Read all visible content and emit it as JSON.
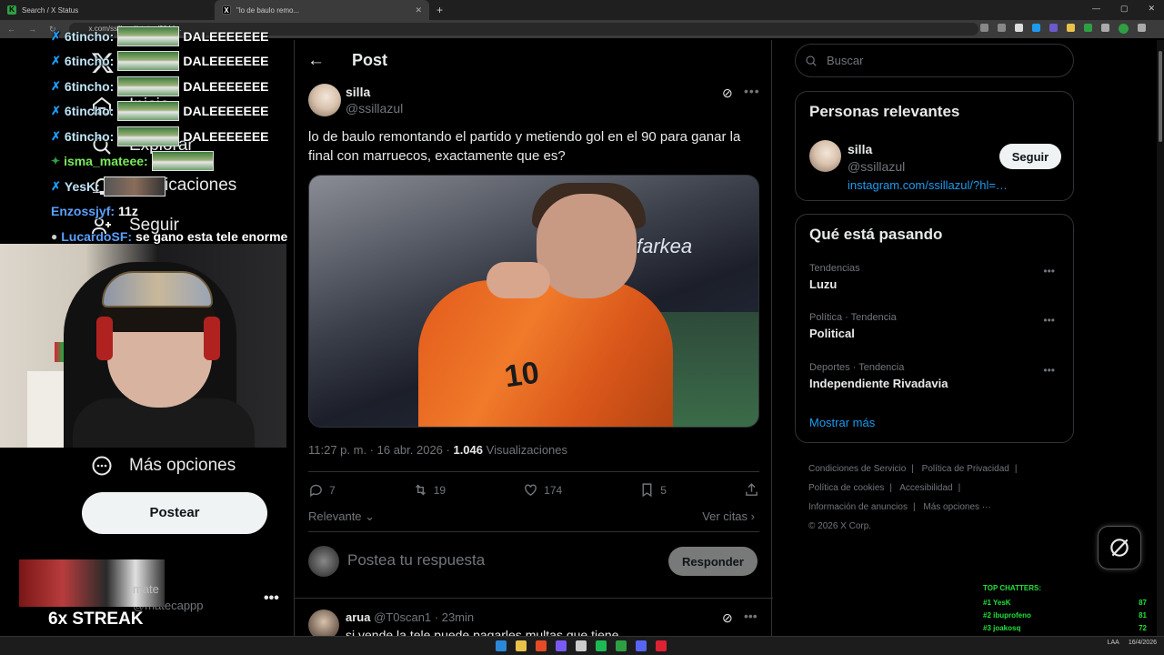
{
  "browser": {
    "tabs": [
      {
        "title": "Search / X Status"
      },
      {
        "title": "\"lo de baulo remo..."
      }
    ],
    "new_tab": "+",
    "url": "x.com/ssillazul/status/2044..."
  },
  "chat_overlay": {
    "lines": [
      {
        "user": "6tincho:",
        "msg": "DALEEEEEEE"
      },
      {
        "user": "6tincho:",
        "msg": "DALEEEEEEE"
      },
      {
        "user": "6tincho:",
        "msg": "DALEEEEEEE"
      },
      {
        "user": "6tincho:",
        "msg": "DALEEEEEEE"
      },
      {
        "user": "6tincho:",
        "msg": "DALEEEEEEE"
      },
      {
        "user": "isma_mateee:",
        "msg": ""
      },
      {
        "user": "YesK:",
        "msg": ""
      },
      {
        "user": "Enzossjyf:",
        "msg": "11z"
      },
      {
        "user": "LucardoSF:",
        "msg": "se gano esta tele enorme"
      }
    ]
  },
  "leftnav": {
    "items": [
      {
        "label": "Inicio"
      },
      {
        "label": "Explorar"
      },
      {
        "label": "Notificaciones"
      },
      {
        "label": "Seguir"
      },
      {
        "label": "Más opciones"
      }
    ],
    "post_button": "Postear",
    "account_handle": "@matecappp",
    "account_more": "•••",
    "overlay_mate": "mate",
    "streak": "6x STREAK"
  },
  "post": {
    "header_title": "Post",
    "author_name": "silla",
    "author_handle": "@ssillazul",
    "text": "lo de baulo remontando el partido y metiendo gol en el 90 para ganar la final con marruecos, exactamente que es?",
    "media_brand": "farkea",
    "media_number": "10",
    "time": "11:27 p. m. · 16 abr. 2026 · ",
    "views_count": "1.046",
    "views_label": "Visualizaciones",
    "replies": "7",
    "reposts": "19",
    "likes": "174",
    "bookmarks": "5",
    "sort_label": "Relevante",
    "quotes_label": "Ver citas",
    "reply_placeholder": "Postea tu respuesta",
    "reply_button": "Responder"
  },
  "comment": {
    "name": "arua",
    "handle": "@T0scan1",
    "time": "· 23min",
    "text": "si vende la tele puede pagarles multas que tiene"
  },
  "sidebar": {
    "search_placeholder": "Buscar",
    "relevant_title": "Personas relevantes",
    "relevant_name": "silla",
    "relevant_handle": "@ssillazul",
    "relevant_link": "instagram.com/ssillazul/?hl=…",
    "follow_button": "Seguir",
    "trends_title": "Qué está pasando",
    "trends": [
      {
        "category": "Tendencias",
        "name": "Luzu"
      },
      {
        "category": "Política · Tendencia",
        "name": "Political"
      },
      {
        "category": "Deportes · Tendencia",
        "name": "Independiente Rivadavia"
      }
    ],
    "show_more": "Mostrar más",
    "footer_links": [
      "Condiciones de Servicio",
      "Política de Privacidad",
      "Política de cookies",
      "Accesibilidad",
      "Información de anuncios",
      "Más opciones ···"
    ],
    "copyright": "© 2026 X Corp."
  },
  "top_chatters": {
    "title": "TOP CHATTERS:",
    "rows": [
      {
        "rank": "#1 YesK",
        "count": "87"
      },
      {
        "rank": "#2 ibuprofeno",
        "count": "81"
      },
      {
        "rank": "#3 joakosq",
        "count": "72"
      }
    ]
  },
  "taskbar": {
    "lang": "LAA",
    "time": "16/4/2026"
  },
  "colors": {
    "background": "#000000",
    "accent": "#1d9bf0",
    "text": "#e7e9ea",
    "muted": "#71767b"
  }
}
